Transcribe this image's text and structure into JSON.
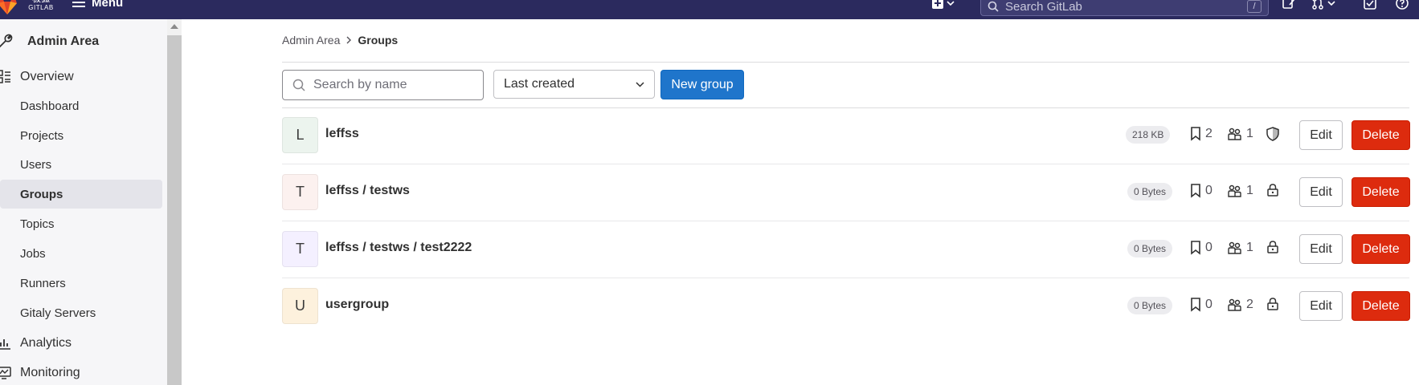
{
  "navbar": {
    "logo_text": "极狐",
    "logo_sub": "GITLAB",
    "menu_label": "Menu",
    "search_placeholder": "Search GitLab",
    "search_shortcut": "/"
  },
  "sidebar": {
    "title": "Admin Area",
    "items": [
      {
        "label": "Overview",
        "section": true,
        "icon": "overview-icon"
      },
      {
        "label": "Dashboard"
      },
      {
        "label": "Projects"
      },
      {
        "label": "Users"
      },
      {
        "label": "Groups",
        "active": true
      },
      {
        "label": "Topics"
      },
      {
        "label": "Jobs"
      },
      {
        "label": "Runners"
      },
      {
        "label": "Gitaly Servers"
      },
      {
        "label": "Analytics",
        "section": true,
        "icon": "analytics-icon"
      },
      {
        "label": "Monitoring",
        "section": true,
        "icon": "monitor-icon"
      }
    ]
  },
  "breadcrumb": {
    "parent": "Admin Area",
    "current": "Groups"
  },
  "filter": {
    "search_placeholder": "Search by name",
    "sort_value": "Last created",
    "new_group_label": "New group"
  },
  "groups": [
    {
      "initial": "L",
      "name": "leffss",
      "size": "218 KB",
      "projects": "2",
      "members": "1",
      "visibility": "shield-icon",
      "avatar_color": "#ecf4ee"
    },
    {
      "initial": "T",
      "name": "leffss / testws",
      "size": "0 Bytes",
      "projects": "0",
      "members": "1",
      "visibility": "lock-icon",
      "avatar_color": "#fcf1ef"
    },
    {
      "initial": "T",
      "name": "leffss / testws / test2222",
      "size": "0 Bytes",
      "projects": "0",
      "members": "1",
      "visibility": "lock-icon",
      "avatar_color": "#f4f0ff"
    },
    {
      "initial": "U",
      "name": "usergroup",
      "size": "0 Bytes",
      "projects": "0",
      "members": "2",
      "visibility": "lock-icon",
      "avatar_color": "#fdf1dd"
    }
  ],
  "actions": {
    "edit_label": "Edit",
    "delete_label": "Delete"
  }
}
